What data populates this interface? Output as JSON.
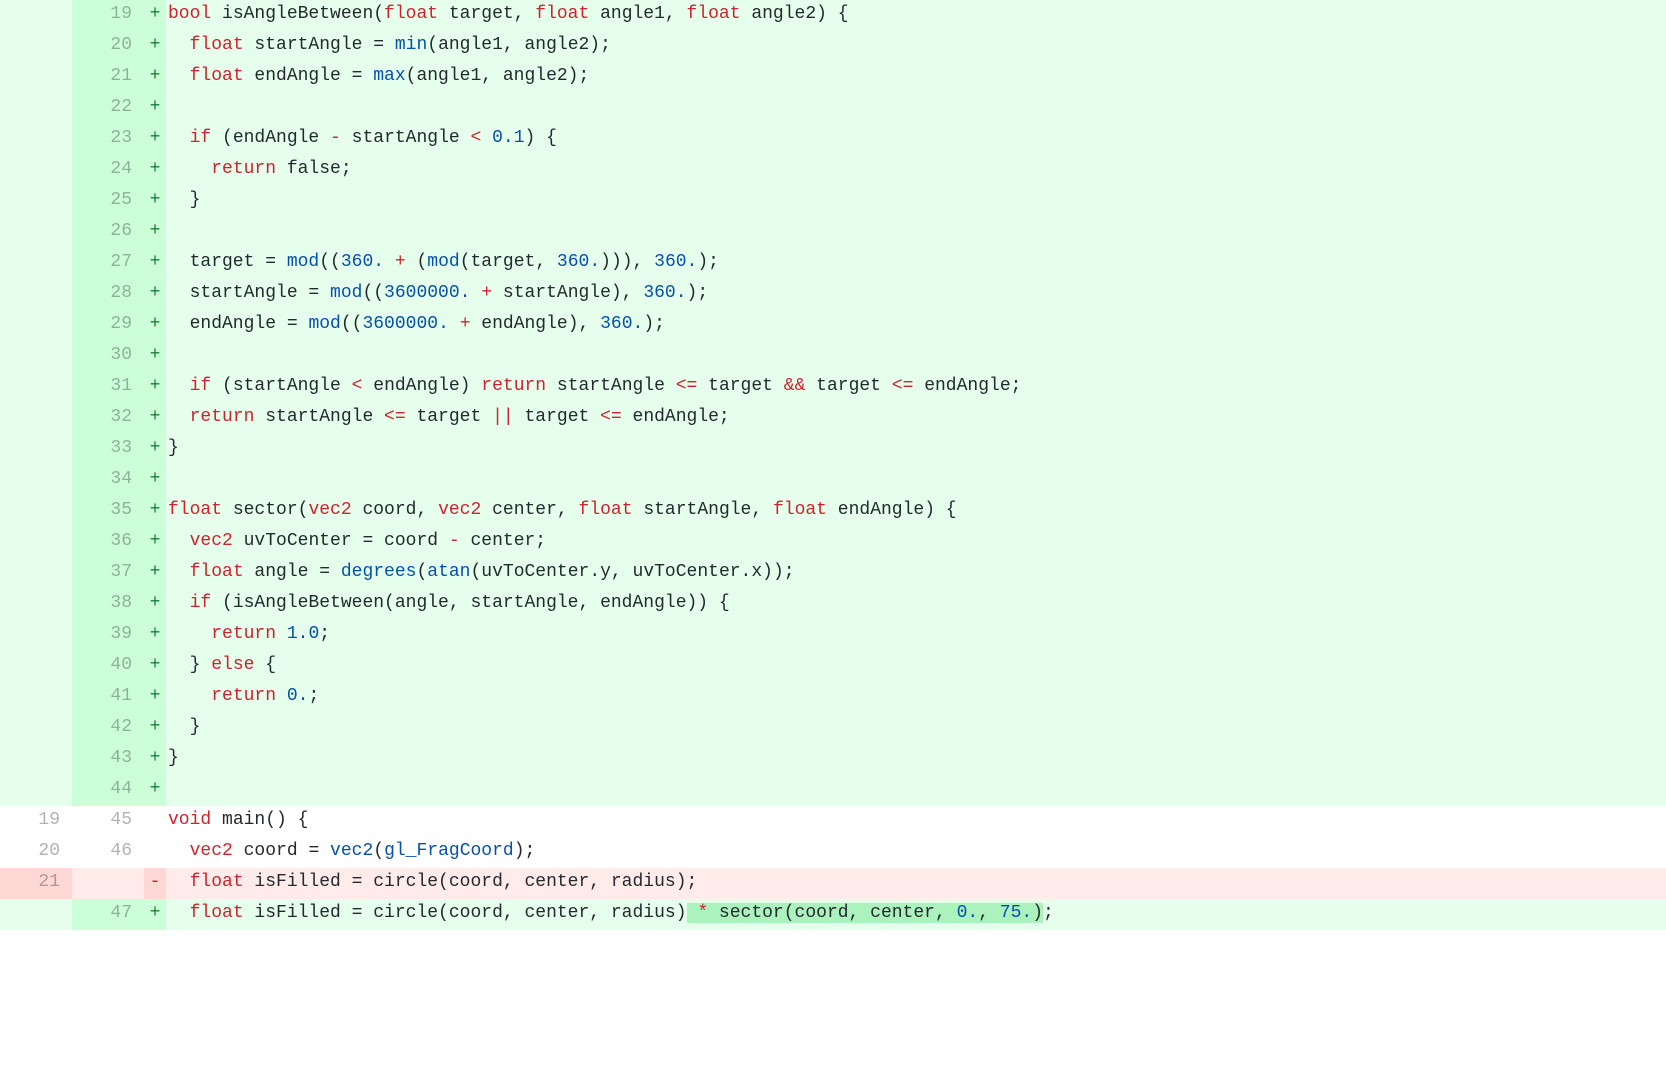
{
  "lines": [
    {
      "type": "add",
      "old": "",
      "new": "19",
      "mark": "+",
      "tokens": [
        {
          "c": "kw",
          "t": "bool"
        },
        {
          "c": "txt",
          "t": " isAngleBetween("
        },
        {
          "c": "kw",
          "t": "float"
        },
        {
          "c": "txt",
          "t": " target, "
        },
        {
          "c": "kw",
          "t": "float"
        },
        {
          "c": "txt",
          "t": " angle1, "
        },
        {
          "c": "kw",
          "t": "float"
        },
        {
          "c": "txt",
          "t": " angle2) {"
        }
      ]
    },
    {
      "type": "add",
      "old": "",
      "new": "20",
      "mark": "+",
      "tokens": [
        {
          "c": "txt",
          "t": "  "
        },
        {
          "c": "kw",
          "t": "float"
        },
        {
          "c": "txt",
          "t": " startAngle = "
        },
        {
          "c": "fn",
          "t": "min"
        },
        {
          "c": "txt",
          "t": "(angle1, angle2);"
        }
      ]
    },
    {
      "type": "add",
      "old": "",
      "new": "21",
      "mark": "+",
      "tokens": [
        {
          "c": "txt",
          "t": "  "
        },
        {
          "c": "kw",
          "t": "float"
        },
        {
          "c": "txt",
          "t": " endAngle = "
        },
        {
          "c": "fn",
          "t": "max"
        },
        {
          "c": "txt",
          "t": "(angle1, angle2);"
        }
      ]
    },
    {
      "type": "add",
      "old": "",
      "new": "22",
      "mark": "+",
      "tokens": []
    },
    {
      "type": "add",
      "old": "",
      "new": "23",
      "mark": "+",
      "tokens": [
        {
          "c": "txt",
          "t": "  "
        },
        {
          "c": "kw",
          "t": "if"
        },
        {
          "c": "txt",
          "t": " (endAngle "
        },
        {
          "c": "op",
          "t": "-"
        },
        {
          "c": "txt",
          "t": " startAngle "
        },
        {
          "c": "op",
          "t": "<"
        },
        {
          "c": "txt",
          "t": " "
        },
        {
          "c": "num",
          "t": "0.1"
        },
        {
          "c": "txt",
          "t": ") {"
        }
      ]
    },
    {
      "type": "add",
      "old": "",
      "new": "24",
      "mark": "+",
      "tokens": [
        {
          "c": "txt",
          "t": "    "
        },
        {
          "c": "kw",
          "t": "return"
        },
        {
          "c": "txt",
          "t": " false;"
        }
      ]
    },
    {
      "type": "add",
      "old": "",
      "new": "25",
      "mark": "+",
      "tokens": [
        {
          "c": "txt",
          "t": "  }"
        }
      ]
    },
    {
      "type": "add",
      "old": "",
      "new": "26",
      "mark": "+",
      "tokens": []
    },
    {
      "type": "add",
      "old": "",
      "new": "27",
      "mark": "+",
      "tokens": [
        {
          "c": "txt",
          "t": "  target = "
        },
        {
          "c": "fn",
          "t": "mod"
        },
        {
          "c": "txt",
          "t": "(("
        },
        {
          "c": "num",
          "t": "360."
        },
        {
          "c": "txt",
          "t": " "
        },
        {
          "c": "op",
          "t": "+"
        },
        {
          "c": "txt",
          "t": " ("
        },
        {
          "c": "fn",
          "t": "mod"
        },
        {
          "c": "txt",
          "t": "(target, "
        },
        {
          "c": "num",
          "t": "360."
        },
        {
          "c": "txt",
          "t": "))), "
        },
        {
          "c": "num",
          "t": "360."
        },
        {
          "c": "txt",
          "t": ");"
        }
      ]
    },
    {
      "type": "add",
      "old": "",
      "new": "28",
      "mark": "+",
      "tokens": [
        {
          "c": "txt",
          "t": "  startAngle = "
        },
        {
          "c": "fn",
          "t": "mod"
        },
        {
          "c": "txt",
          "t": "(("
        },
        {
          "c": "num",
          "t": "3600000."
        },
        {
          "c": "txt",
          "t": " "
        },
        {
          "c": "op",
          "t": "+"
        },
        {
          "c": "txt",
          "t": " startAngle), "
        },
        {
          "c": "num",
          "t": "360."
        },
        {
          "c": "txt",
          "t": ");"
        }
      ]
    },
    {
      "type": "add",
      "old": "",
      "new": "29",
      "mark": "+",
      "tokens": [
        {
          "c": "txt",
          "t": "  endAngle = "
        },
        {
          "c": "fn",
          "t": "mod"
        },
        {
          "c": "txt",
          "t": "(("
        },
        {
          "c": "num",
          "t": "3600000."
        },
        {
          "c": "txt",
          "t": " "
        },
        {
          "c": "op",
          "t": "+"
        },
        {
          "c": "txt",
          "t": " endAngle), "
        },
        {
          "c": "num",
          "t": "360."
        },
        {
          "c": "txt",
          "t": ");"
        }
      ]
    },
    {
      "type": "add",
      "old": "",
      "new": "30",
      "mark": "+",
      "tokens": []
    },
    {
      "type": "add",
      "old": "",
      "new": "31",
      "mark": "+",
      "tokens": [
        {
          "c": "txt",
          "t": "  "
        },
        {
          "c": "kw",
          "t": "if"
        },
        {
          "c": "txt",
          "t": " (startAngle "
        },
        {
          "c": "op",
          "t": "<"
        },
        {
          "c": "txt",
          "t": " endAngle) "
        },
        {
          "c": "kw",
          "t": "return"
        },
        {
          "c": "txt",
          "t": " startAngle "
        },
        {
          "c": "op",
          "t": "<="
        },
        {
          "c": "txt",
          "t": " target "
        },
        {
          "c": "op",
          "t": "&&"
        },
        {
          "c": "txt",
          "t": " target "
        },
        {
          "c": "op",
          "t": "<="
        },
        {
          "c": "txt",
          "t": " endAngle;"
        }
      ]
    },
    {
      "type": "add",
      "old": "",
      "new": "32",
      "mark": "+",
      "tokens": [
        {
          "c": "txt",
          "t": "  "
        },
        {
          "c": "kw",
          "t": "return"
        },
        {
          "c": "txt",
          "t": " startAngle "
        },
        {
          "c": "op",
          "t": "<="
        },
        {
          "c": "txt",
          "t": " target "
        },
        {
          "c": "op",
          "t": "||"
        },
        {
          "c": "txt",
          "t": " target "
        },
        {
          "c": "op",
          "t": "<="
        },
        {
          "c": "txt",
          "t": " endAngle;"
        }
      ]
    },
    {
      "type": "add",
      "old": "",
      "new": "33",
      "mark": "+",
      "tokens": [
        {
          "c": "txt",
          "t": "}"
        }
      ]
    },
    {
      "type": "add",
      "old": "",
      "new": "34",
      "mark": "+",
      "tokens": []
    },
    {
      "type": "add",
      "old": "",
      "new": "35",
      "mark": "+",
      "tokens": [
        {
          "c": "kw",
          "t": "float"
        },
        {
          "c": "txt",
          "t": " sector("
        },
        {
          "c": "kw",
          "t": "vec2"
        },
        {
          "c": "txt",
          "t": " coord, "
        },
        {
          "c": "kw",
          "t": "vec2"
        },
        {
          "c": "txt",
          "t": " center, "
        },
        {
          "c": "kw",
          "t": "float"
        },
        {
          "c": "txt",
          "t": " startAngle, "
        },
        {
          "c": "kw",
          "t": "float"
        },
        {
          "c": "txt",
          "t": " endAngle) {"
        }
      ]
    },
    {
      "type": "add",
      "old": "",
      "new": "36",
      "mark": "+",
      "tokens": [
        {
          "c": "txt",
          "t": "  "
        },
        {
          "c": "kw",
          "t": "vec2"
        },
        {
          "c": "txt",
          "t": " uvToCenter = coord "
        },
        {
          "c": "op",
          "t": "-"
        },
        {
          "c": "txt",
          "t": " center;"
        }
      ]
    },
    {
      "type": "add",
      "old": "",
      "new": "37",
      "mark": "+",
      "tokens": [
        {
          "c": "txt",
          "t": "  "
        },
        {
          "c": "kw",
          "t": "float"
        },
        {
          "c": "txt",
          "t": " angle = "
        },
        {
          "c": "fn",
          "t": "degrees"
        },
        {
          "c": "txt",
          "t": "("
        },
        {
          "c": "fn",
          "t": "atan"
        },
        {
          "c": "txt",
          "t": "(uvToCenter.y, uvToCenter.x));"
        }
      ]
    },
    {
      "type": "add",
      "old": "",
      "new": "38",
      "mark": "+",
      "tokens": [
        {
          "c": "txt",
          "t": "  "
        },
        {
          "c": "kw",
          "t": "if"
        },
        {
          "c": "txt",
          "t": " (isAngleBetween(angle, startAngle, endAngle)) {"
        }
      ]
    },
    {
      "type": "add",
      "old": "",
      "new": "39",
      "mark": "+",
      "tokens": [
        {
          "c": "txt",
          "t": "    "
        },
        {
          "c": "kw",
          "t": "return"
        },
        {
          "c": "txt",
          "t": " "
        },
        {
          "c": "num",
          "t": "1.0"
        },
        {
          "c": "txt",
          "t": ";"
        }
      ]
    },
    {
      "type": "add",
      "old": "",
      "new": "40",
      "mark": "+",
      "tokens": [
        {
          "c": "txt",
          "t": "  } "
        },
        {
          "c": "kw",
          "t": "else"
        },
        {
          "c": "txt",
          "t": " {"
        }
      ]
    },
    {
      "type": "add",
      "old": "",
      "new": "41",
      "mark": "+",
      "tokens": [
        {
          "c": "txt",
          "t": "    "
        },
        {
          "c": "kw",
          "t": "return"
        },
        {
          "c": "txt",
          "t": " "
        },
        {
          "c": "num",
          "t": "0."
        },
        {
          "c": "txt",
          "t": ";"
        }
      ]
    },
    {
      "type": "add",
      "old": "",
      "new": "42",
      "mark": "+",
      "tokens": [
        {
          "c": "txt",
          "t": "  }"
        }
      ]
    },
    {
      "type": "add",
      "old": "",
      "new": "43",
      "mark": "+",
      "tokens": [
        {
          "c": "txt",
          "t": "}"
        }
      ]
    },
    {
      "type": "add",
      "old": "",
      "new": "44",
      "mark": "+",
      "tokens": []
    },
    {
      "type": "ctx",
      "old": "19",
      "new": "45",
      "mark": " ",
      "tokens": [
        {
          "c": "kw",
          "t": "void"
        },
        {
          "c": "txt",
          "t": " main() {"
        }
      ]
    },
    {
      "type": "ctx",
      "old": "20",
      "new": "46",
      "mark": " ",
      "tokens": [
        {
          "c": "txt",
          "t": "  "
        },
        {
          "c": "kw",
          "t": "vec2"
        },
        {
          "c": "txt",
          "t": " coord = "
        },
        {
          "c": "fn",
          "t": "vec2"
        },
        {
          "c": "txt",
          "t": "("
        },
        {
          "c": "fn",
          "t": "gl_FragCoord"
        },
        {
          "c": "txt",
          "t": ");"
        }
      ]
    },
    {
      "type": "del",
      "old": "21",
      "new": "",
      "mark": "-",
      "tokens": [
        {
          "c": "txt",
          "t": "  "
        },
        {
          "c": "kw",
          "t": "float"
        },
        {
          "c": "txt",
          "t": " isFilled = circle(coord, center, radius);"
        }
      ]
    },
    {
      "type": "add",
      "old": "",
      "new": "47",
      "mark": "+",
      "tokens": [
        {
          "c": "txt",
          "t": "  "
        },
        {
          "c": "kw",
          "t": "float"
        },
        {
          "c": "txt",
          "t": " isFilled = circle(coord, center, radius)"
        },
        {
          "c": "txt",
          "t": " ",
          "hl": "add"
        },
        {
          "c": "op",
          "t": "*",
          "hl": "add"
        },
        {
          "c": "txt",
          "t": " sector(coord, center, ",
          "hl": "add"
        },
        {
          "c": "num",
          "t": "0.",
          "hl": "add"
        },
        {
          "c": "txt",
          "t": ", ",
          "hl": "add"
        },
        {
          "c": "num",
          "t": "75.",
          "hl": "add"
        },
        {
          "c": "txt",
          "t": ")",
          "hl": "add"
        },
        {
          "c": "txt",
          "t": ";"
        }
      ]
    }
  ]
}
